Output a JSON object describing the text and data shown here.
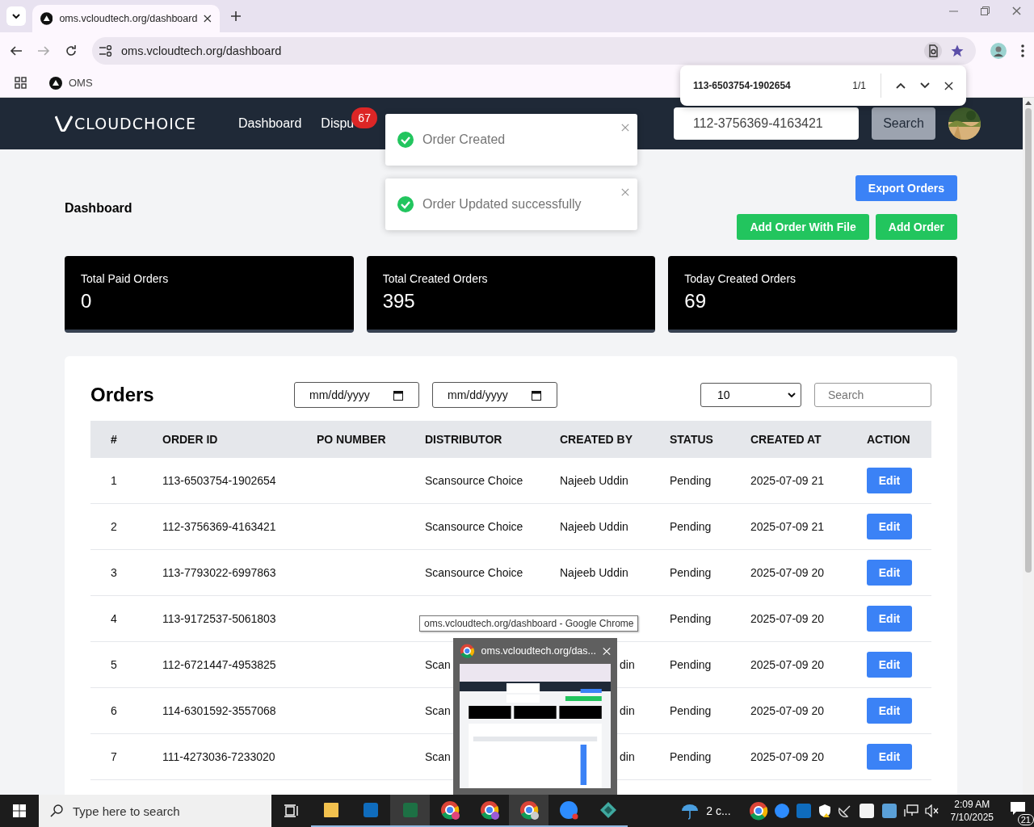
{
  "browser": {
    "tabs": [
      {
        "title": "oms.vcloudtech.org/dashboard",
        "selected": true
      }
    ],
    "address": "oms.vcloudtech.org/dashboard",
    "bookmarks": [
      "OMS"
    ],
    "find_bar": {
      "query": "113-6503754-1902654",
      "count": "1/1"
    }
  },
  "navbar": {
    "logo": "CLOUDCHOICE",
    "links": [
      {
        "label": "Dashboard"
      },
      {
        "label": "Dispu",
        "badge": "67"
      }
    ],
    "search": {
      "value": "112-3756369-4163421"
    },
    "search_button": "Search"
  },
  "toasts": [
    {
      "message": "Order Created"
    },
    {
      "message": "Order Updated successfully"
    }
  ],
  "dashboard": {
    "title": "Dashboard",
    "export_button": "Export Orders",
    "buttons": [
      "Add Order With File",
      "Add Order"
    ]
  },
  "stats": [
    {
      "label": "Total Paid Orders",
      "value": "0"
    },
    {
      "label": "Total Created Orders",
      "value": "395"
    },
    {
      "label": "Today Created Orders",
      "value": "69"
    }
  ],
  "orders": {
    "title": "Orders",
    "date_fields": [
      {
        "placeholder": "mm/dd/yyyy"
      },
      {
        "placeholder": "mm/dd/yyyy"
      }
    ],
    "page_size": "10",
    "search": {
      "placeholder": "Search"
    },
    "columns": [
      "#",
      "ORDER ID",
      "PO NUMBER",
      "DISTRIBUTOR",
      "CREATED BY",
      "STATUS",
      "CREATED AT",
      "ACTION"
    ],
    "rows": [
      {
        "n": "1",
        "order_id": "113-6503754-1902654",
        "distributor": "Scansource Choice",
        "created_by": "Najeeb Uddin",
        "status": "Pending",
        "created_at": "2025-07-09 21",
        "action": "Edit"
      },
      {
        "n": "2",
        "order_id": "112-3756369-4163421",
        "distributor": "Scansource Choice",
        "created_by": "Najeeb Uddin",
        "status": "Pending",
        "created_at": "2025-07-09 21",
        "action": "Edit"
      },
      {
        "n": "3",
        "order_id": "113-7793022-6997863",
        "distributor": "Scansource Choice",
        "created_by": "Najeeb Uddin",
        "status": "Pending",
        "created_at": "2025-07-09 20",
        "action": "Edit"
      },
      {
        "n": "4",
        "order_id": "113-9172537-5061803",
        "status": "Pending",
        "created_at": "2025-07-09 20",
        "action": "Edit"
      },
      {
        "n": "5",
        "order_id": "112-6721447-4953825",
        "distributor": "Scan",
        "created_by": "din",
        "status": "Pending",
        "created_at": "2025-07-09 20",
        "action": "Edit"
      },
      {
        "n": "6",
        "order_id": "114-6301592-3557068",
        "distributor": "Scan",
        "created_by": "din",
        "status": "Pending",
        "created_at": "2025-07-09 20",
        "action": "Edit"
      },
      {
        "n": "7",
        "order_id": "111-4273036-7233020",
        "distributor": "Scan",
        "created_by": "din",
        "status": "Pending",
        "created_at": "2025-07-09 20",
        "action": "Edit"
      }
    ]
  },
  "tooltip": "oms.vcloudtech.org/dashboard - Google Chrome",
  "preview": {
    "title": "oms.vcloudtech.org/das..."
  },
  "taskbar": {
    "search": {
      "placeholder": "Type here to search"
    },
    "weather": "2 c...",
    "time": "2:09 AM",
    "date": "7/10/2025",
    "notifications": "21"
  }
}
